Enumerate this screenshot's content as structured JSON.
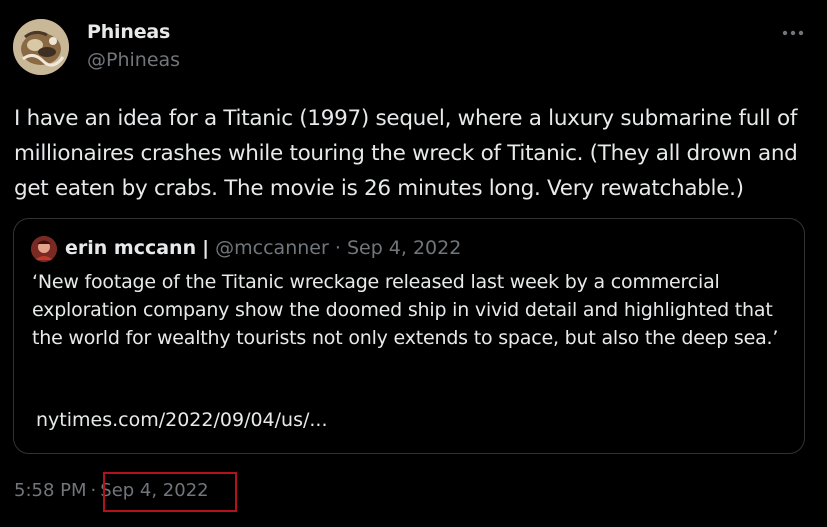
{
  "author": {
    "name": "Phineas",
    "handle": "@Phineas"
  },
  "more_icon": "more-horizontal-icon",
  "tweet": {
    "text": "I have an idea for a Titanic (1997) sequel, where a luxury submarine full of millionaires crashes while touring the wreck of Titanic. (They all drown and get eaten by crabs. The movie is 26 minutes long. Very rewatchable.)",
    "time": "5:58 PM",
    "separator": "·",
    "date": "Sep 4, 2022"
  },
  "quote": {
    "name": "erin mccann",
    "name_separator": "|",
    "handle": "@mccanner",
    "dot": "·",
    "date": "Sep 4, 2022",
    "text": "‘New footage of the Titanic wreckage released last week by a commercial exploration company show the doomed ship in vivid detail and highlighted that the world for wealthy tourists not only extends to space, but also the deep sea.’",
    "link": "nytimes.com/2022/09/04/us/..."
  },
  "colors": {
    "background": "#000000",
    "primary_text": "#e7e9ea",
    "secondary_text": "#71767b",
    "border": "#2f3336",
    "highlight_box": "#b3121a"
  }
}
